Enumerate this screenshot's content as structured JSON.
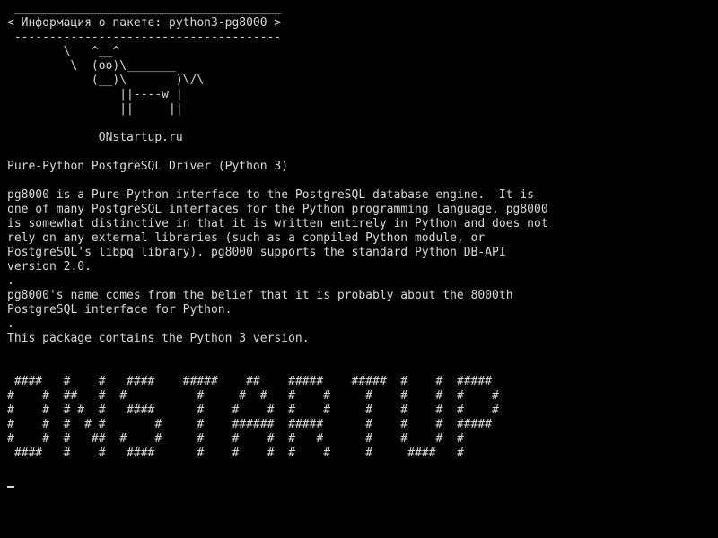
{
  "terminal": {
    "cowsay_header": [
      " ______________________________________",
      "< Информация о пакете: python3-pg8000 >",
      " --------------------------------------"
    ],
    "cow_art": [
      "        \\   ^__^",
      "         \\  (oo)\\_______",
      "            (__)\\       )\\/\\",
      "                ||----w |",
      "                ||     ||"
    ],
    "site_label": "             ONstartup.ru",
    "package_summary": "Pure-Python PostgreSQL Driver (Python 3)",
    "description_lines": [
      "pg8000 is a Pure-Python interface to the PostgreSQL database engine.  It is",
      "one of many PostgreSQL interfaces for the Python programming language. pg8000",
      "is somewhat distinctive in that it is written entirely in Python and does not",
      "rely on any external libraries (such as a compiled Python module, or",
      "PostgreSQL's libpq library). pg8000 supports the standard Python DB-API",
      "version 2.0.",
      ".",
      "pg8000's name comes from the belief that it is probably about the 8000th",
      "PostgreSQL interface for Python.",
      ".",
      "This package contains the Python 3 version."
    ],
    "figlet_banner": [
      " ####   #    #   ####    #####    ##    #####    #####  #    #  #####",
      "#    #  ##   #  #          #     #  #   #    #     #    #    #  #    #",
      "#    #  # #  #   ####      #    #    #  #    #     #    #    #  #    #",
      "#    #  #  # #       #     #    ######  #####      #    #    #  #####",
      "#    #  #   ##  #    #     #    #    #  #   #      #    #    #  #",
      " ####   #    #   ####      #    #    #  #    #     #     ####   #"
    ]
  }
}
